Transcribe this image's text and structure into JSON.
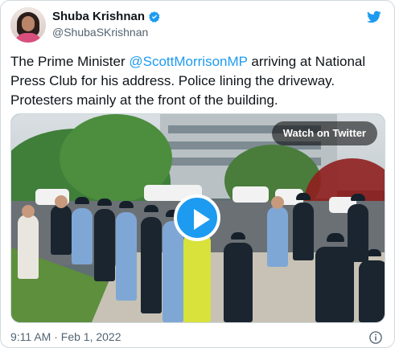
{
  "author": {
    "display_name": "Shuba Krishnan",
    "handle": "@ShubaSKrishnan",
    "verified": true
  },
  "tweet": {
    "text_before": "The Prime Minister ",
    "mention": "@ScottMorrisonMP",
    "text_after": " arriving at National Press Club for his address. Police lining the driveway. Protesters mainly at the front of the building.",
    "timestamp": "9:11 AM · Feb 1, 2022"
  },
  "media": {
    "watch_label": "Watch on Twitter",
    "play_icon": "play-icon"
  },
  "icons": {
    "verified": "verified-badge-icon",
    "brand": "twitter-bird-icon",
    "info": "info-icon"
  },
  "colors": {
    "accent": "#1d9bf0",
    "text": "#0f1419",
    "muted": "#536471",
    "border": "#cfd9de"
  }
}
